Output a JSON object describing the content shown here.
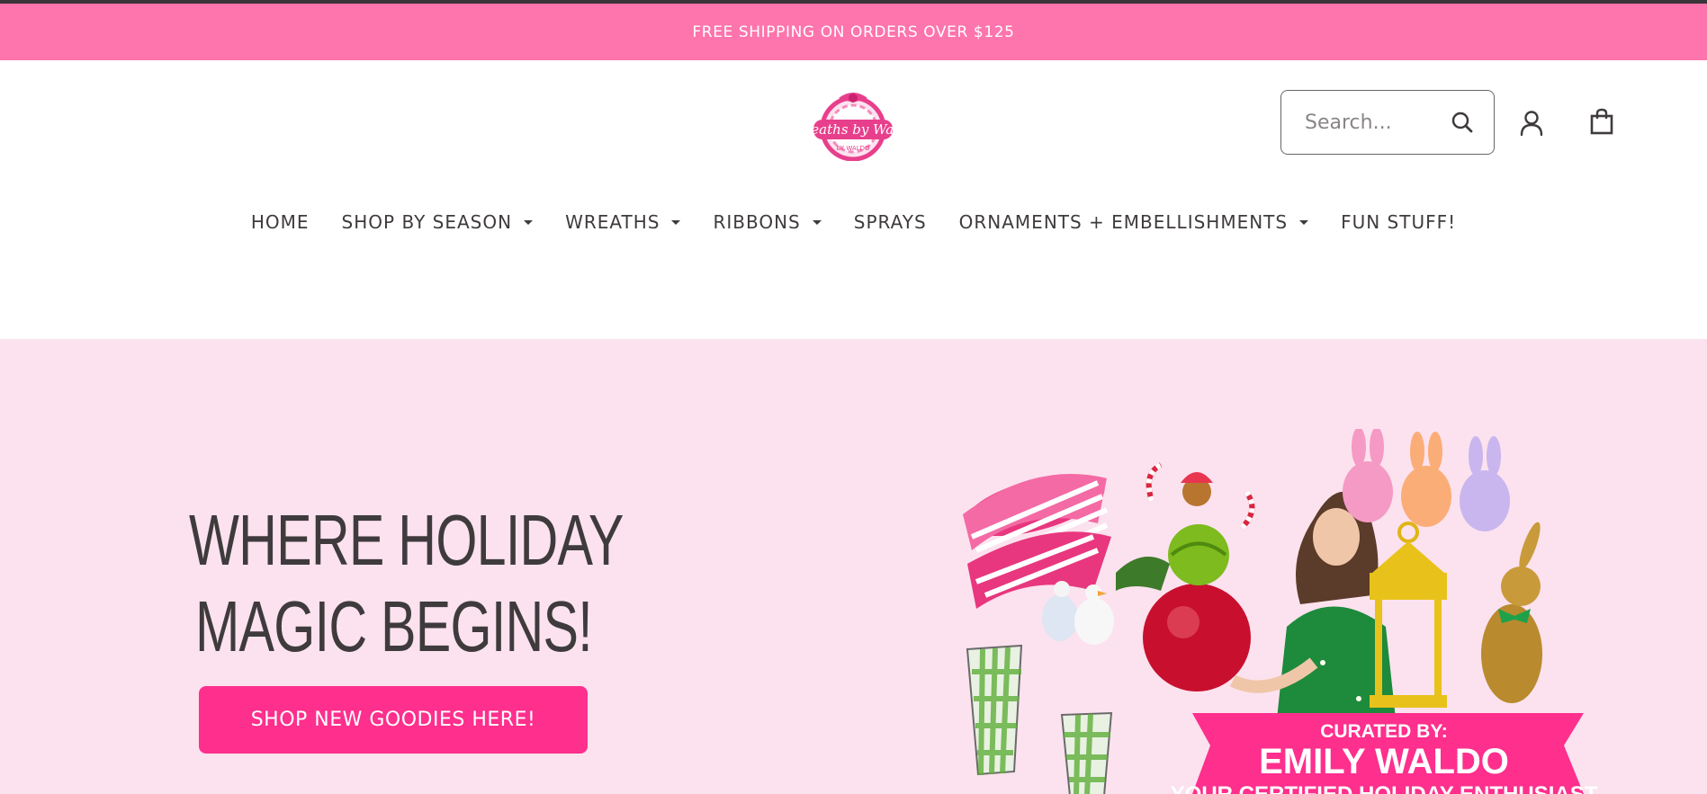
{
  "announcement": "FREE SHIPPING ON ORDERS OVER $125",
  "header": {
    "logo_alt": "Wreaths by Waldo",
    "search_placeholder": "Search..."
  },
  "nav": [
    {
      "label": "HOME",
      "dropdown": false
    },
    {
      "label": "SHOP BY SEASON",
      "dropdown": true
    },
    {
      "label": "WREATHS",
      "dropdown": true
    },
    {
      "label": "RIBBONS",
      "dropdown": true
    },
    {
      "label": "SPRAYS",
      "dropdown": false
    },
    {
      "label": "ORNAMENTS + EMBELLISHMENTS",
      "dropdown": true
    },
    {
      "label": "FUN STUFF!",
      "dropdown": false
    }
  ],
  "hero": {
    "title_line1": "WHERE HOLIDAY",
    "title_line2": "MAGIC BEGINS!",
    "cta_label": "SHOP NEW GOODIES HERE!",
    "banner": {
      "line1": "CURATED BY:",
      "line2": "EMILY WALDO",
      "line3": "YOUR CERTIFIED HOLIDAY ENTHUSIAST"
    }
  },
  "colors": {
    "announcement_bg": "#fe74ac",
    "hero_bg": "#fbe2ee",
    "cta_bg": "#fe2f8d",
    "text": "#3f3b3d"
  }
}
